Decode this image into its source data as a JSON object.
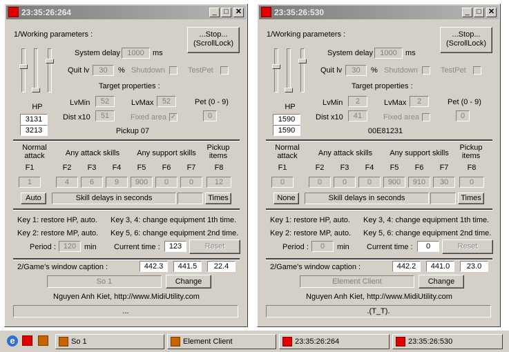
{
  "windows": [
    {
      "title": "23:35:26:264",
      "working_params": "1/Working parameters :",
      "stop_btn": "...Stop...\n(ScrollLock)",
      "system_delay_label": "System delay",
      "system_delay": "1000",
      "ms": "ms",
      "quit_lv_label": "Quit lv",
      "quit_lv": "30",
      "pct": "%",
      "shutdown": "Shutdown",
      "testpet": "TestPet",
      "target_props": "Target properties :",
      "hp_label": "HP",
      "hp1": "3131",
      "hp2": "3213",
      "lvmin_label": "LvMin",
      "lvmin": "52",
      "lvmax_label": "LvMax",
      "lvmax": "52",
      "pet_label": "Pet (0 - 9)",
      "pet": "0",
      "dist_label": "Dist x10",
      "dist": "51",
      "fixed_area": "Fixed area",
      "fixed_checked": true,
      "target_name": "Pickup 07",
      "normal_attack": "Normal\nattack",
      "any_attack": "Any attack skills",
      "any_support": "Any support skills",
      "pickup_items": "Pickup\nitems",
      "fkeys": [
        "F1",
        "F2",
        "F3",
        "F4",
        "F5",
        "F6",
        "F7",
        "F8"
      ],
      "fvals": [
        "1",
        "4",
        "6",
        "9",
        "900",
        "0",
        "0",
        "12"
      ],
      "mode": "Auto",
      "skill_delays": "Skill delays in seconds",
      "times": "Times",
      "key1": "Key 1: restore HP, auto.",
      "key34": "Key 3, 4: change equipment 1th time.",
      "key2": "Key 2: restore MP, auto.",
      "key56": "Key 5, 6: change equipment 2nd time.",
      "period_label": "Period :",
      "period": "120",
      "min": "min",
      "cur_time_label": "Current time :",
      "cur_time": "123",
      "reset": "Reset",
      "caption_label": "2/Game's window caption :",
      "c1": "442.3",
      "c2": "441.5",
      "c3": "22.4",
      "caption_value": "So 1",
      "change": "Change",
      "credit": "Nguyen Anh Kiet, http://www.MidiUtility.com",
      "status": "..."
    },
    {
      "title": "23:35:26:530",
      "working_params": "1/Working parameters :",
      "stop_btn": "...Stop...\n(ScrollLock)",
      "system_delay_label": "System delay",
      "system_delay": "1000",
      "ms": "ms",
      "quit_lv_label": "Quit lv",
      "quit_lv": "30",
      "pct": "%",
      "shutdown": "Shutdown",
      "testpet": "TestPet",
      "target_props": "Target properties :",
      "hp_label": "HP",
      "hp1": "1590",
      "hp2": "1590",
      "lvmin_label": "LvMin",
      "lvmin": "2",
      "lvmax_label": "LvMax",
      "lvmax": "2",
      "pet_label": "Pet (0 - 9)",
      "pet": "0",
      "dist_label": "Dist x10",
      "dist": "41",
      "fixed_area": "Fixed area",
      "fixed_checked": false,
      "target_name": "00E81231",
      "normal_attack": "Normal\nattack",
      "any_attack": "Any attack skills",
      "any_support": "Any support skills",
      "pickup_items": "Pickup\nitems",
      "fkeys": [
        "F1",
        "F2",
        "F3",
        "F4",
        "F5",
        "F6",
        "F7",
        "F8"
      ],
      "fvals": [
        "0",
        "0",
        "0",
        "0",
        "900",
        "910",
        "30",
        "0"
      ],
      "mode": "None",
      "skill_delays": "Skill delays in seconds",
      "times": "Times",
      "key1": "Key 1: restore HP, auto.",
      "key34": "Key 3, 4: change equipment 1th time.",
      "key2": "Key 2: restore MP, auto.",
      "key56": "Key 5, 6: change equipment 2nd time.",
      "period_label": "Period :",
      "period": "0",
      "min": "min",
      "cur_time_label": "Current time :",
      "cur_time": "0",
      "reset": "Reset",
      "caption_label": "2/Game's window caption :",
      "c1": "442.2",
      "c2": "441.0",
      "c3": "23.0",
      "caption_value": "Element Client",
      "change": "Change",
      "credit": "Nguyen Anh Kiet, http://www.MidiUtility.com",
      "status": ".(T_T)."
    }
  ],
  "taskbar": {
    "tasks": [
      {
        "label": "So 1",
        "icon": "app-icon"
      },
      {
        "label": "Element Client",
        "icon": "app-icon"
      },
      {
        "label": "23:35:26:264",
        "icon": "red-window-icon"
      },
      {
        "label": "23:35:26:530",
        "icon": "red-window-icon"
      }
    ]
  },
  "colors": {
    "window_bg": "#d4d0c8",
    "title_inactive": "#8c8c8c",
    "red_icon": "#e00000"
  }
}
